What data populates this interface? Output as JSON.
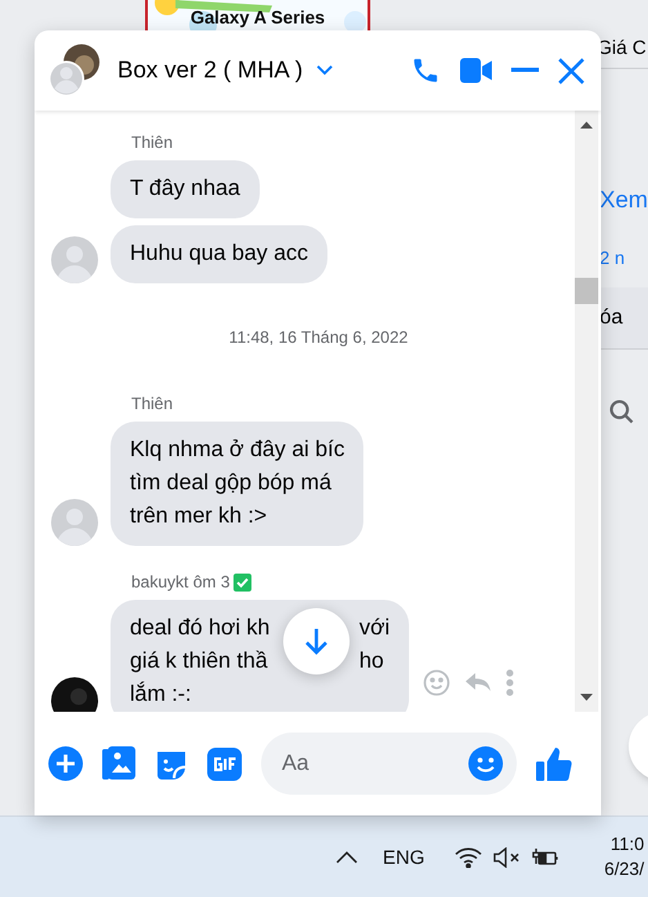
{
  "ad_banner": {
    "title": "Galaxy A Series"
  },
  "background_page": {
    "items": [
      {
        "kind": "title",
        "text": "Giá C"
      },
      {
        "kind": "link",
        "text": "Xem"
      },
      {
        "kind": "meta",
        "text": "2 n"
      },
      {
        "kind": "row",
        "text": "óa"
      },
      {
        "kind": "search"
      }
    ]
  },
  "chat": {
    "title": "Box ver 2 ( MHA )",
    "messages": [
      {
        "kind": "sender",
        "name": "Thiên",
        "verified": false
      },
      {
        "kind": "bubble",
        "lines": [
          [
            "T đây nhaa"
          ]
        ]
      },
      {
        "kind": "bubble",
        "lines": [
          [
            "Huhu qua bay acc"
          ]
        ],
        "avatar": {
          "kind": "blank"
        }
      },
      {
        "kind": "time",
        "text": "11:48, 16 Tháng 6, 2022"
      },
      {
        "kind": "sender",
        "name": "Thiên",
        "verified": false
      },
      {
        "kind": "bubble",
        "lines": [
          [
            "Klq nhma ở đây ai bíc"
          ],
          [
            "tìm deal gộp bóp má"
          ],
          [
            "trên mer kh :>"
          ]
        ],
        "avatar": {
          "kind": "blank"
        }
      },
      {
        "kind": "sender",
        "name": "bakuykt ôm 3",
        "verified": true
      },
      {
        "kind": "bubble",
        "lines": [
          [
            "deal đó hơi kh",
            "với"
          ],
          [
            "giá k thiên thầ",
            "ho"
          ],
          [
            "lắm :-:"
          ]
        ],
        "avatar": {
          "kind": "dark"
        },
        "actions": true
      }
    ],
    "composer": {
      "placeholder": "Aa"
    }
  },
  "taskbar": {
    "language": "ENG",
    "muted": true,
    "time": "11:0",
    "date": "6/23/"
  }
}
